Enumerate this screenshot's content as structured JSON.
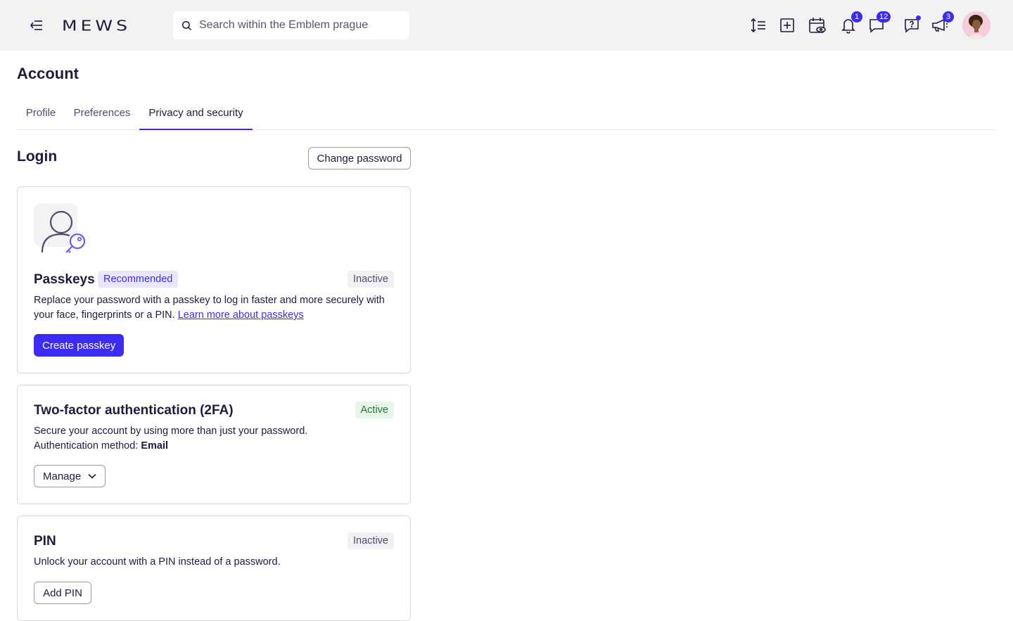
{
  "topbar": {
    "logo": "MEWS",
    "search_placeholder": "Search within the Emblem prague",
    "notifications_count": "1",
    "messages_count": "12",
    "announcements_count": "3"
  },
  "page": {
    "title": "Account",
    "tabs": [
      {
        "label": "Profile",
        "active": false
      },
      {
        "label": "Preferences",
        "active": false
      },
      {
        "label": "Privacy and security",
        "active": true
      }
    ]
  },
  "login": {
    "title": "Login",
    "change_password_label": "Change password"
  },
  "passkeys": {
    "title": "Passkeys",
    "tag": "Recommended",
    "status": "Inactive",
    "description": "Replace your password with a passkey to log in faster and more securely with your face, fingerprints or a PIN.",
    "link": "Learn more about passkeys",
    "button": "Create passkey"
  },
  "two_factor": {
    "title": "Two-factor authentication (2FA)",
    "status": "Active",
    "description": "Secure your account by using more than just your password.",
    "method_label": "Authentication method:",
    "method_value": "Email",
    "button": "Manage"
  },
  "pin": {
    "title": "PIN",
    "status": "Inactive",
    "description": "Unlock your account with a PIN instead of a password.",
    "button": "Add PIN"
  },
  "colors": {
    "accent": "#3c2bf5",
    "topbar_bg": "#f2f2f2",
    "active_status": "#1f7a35"
  }
}
